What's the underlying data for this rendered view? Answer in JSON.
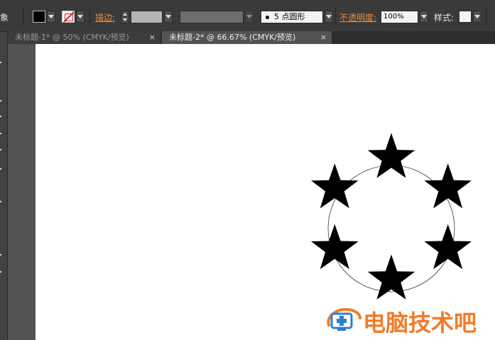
{
  "control_bar": {
    "truncated_label": "象",
    "stroke_label": "描边:",
    "brush_value": "5 点圆形",
    "opacity_label": "不透明度:",
    "opacity_value": "100%",
    "style_label": "样式:",
    "fill_color": "#000000",
    "stroke_none_indicator_color": "#d02020"
  },
  "tabs": [
    {
      "label": "未标题-1* @ 50% (CMYK/预览)",
      "close": "×",
      "active": false
    },
    {
      "label": "未标题-2* @ 66.67% (CMYK/预览)",
      "close": "×",
      "active": true
    }
  ],
  "artwork": {
    "star_count": 6,
    "star_color": "#000000",
    "guide_circle": "thin black circle",
    "background": "#ffffff"
  },
  "watermark": {
    "text": "电脑技术吧",
    "icon": "computer-cross-logo",
    "color": "#f07c2a"
  }
}
